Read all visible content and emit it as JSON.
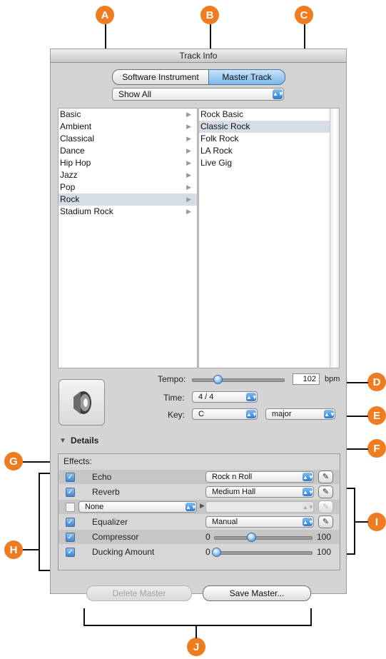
{
  "callouts": {
    "a": "A",
    "b": "B",
    "c": "C",
    "d": "D",
    "e": "E",
    "f": "F",
    "g": "G",
    "h": "H",
    "i": "I",
    "j": "J"
  },
  "window": {
    "title": "Track Info"
  },
  "track_type": {
    "software_instrument": "Software Instrument",
    "master_track": "Master Track",
    "selected": "Master Track"
  },
  "filter": {
    "value": "Show All"
  },
  "genres": [
    "Basic",
    "Ambient",
    "Classical",
    "Dance",
    "Hip Hop",
    "Jazz",
    "Pop",
    "Rock",
    "Stadium Rock"
  ],
  "selected_genre": "Rock",
  "presets": [
    "Rock Basic",
    "Classic Rock",
    "Folk Rock",
    "LA Rock",
    "Live Gig"
  ],
  "selected_preset": "Classic Rock",
  "tempo": {
    "label": "Tempo:",
    "value": "102",
    "unit": "bpm",
    "slider_level": 0.28
  },
  "time": {
    "label": "Time:",
    "value": "4 / 4"
  },
  "key": {
    "label": "Key:",
    "note": "C",
    "mode": "major"
  },
  "details": {
    "label": "Details"
  },
  "effects": {
    "label": "Effects:",
    "echo": {
      "name": "Echo",
      "preset": "Rock n Roll"
    },
    "reverb": {
      "name": "Reverb",
      "preset": "Medium Hall"
    },
    "extra": {
      "name": "None",
      "preset": ""
    },
    "equalizer": {
      "name": "Equalizer",
      "preset": "Manual"
    },
    "compressor": {
      "name": "Compressor",
      "min": "0",
      "max": "100",
      "level": 0.38
    },
    "ducking": {
      "name": "Ducking Amount",
      "min": "0",
      "max": "100",
      "level": 0.02
    }
  },
  "buttons": {
    "delete": "Delete Master",
    "save": "Save Master..."
  },
  "colors": {
    "callout": "#f07c22",
    "accent": "#3a86d6"
  }
}
